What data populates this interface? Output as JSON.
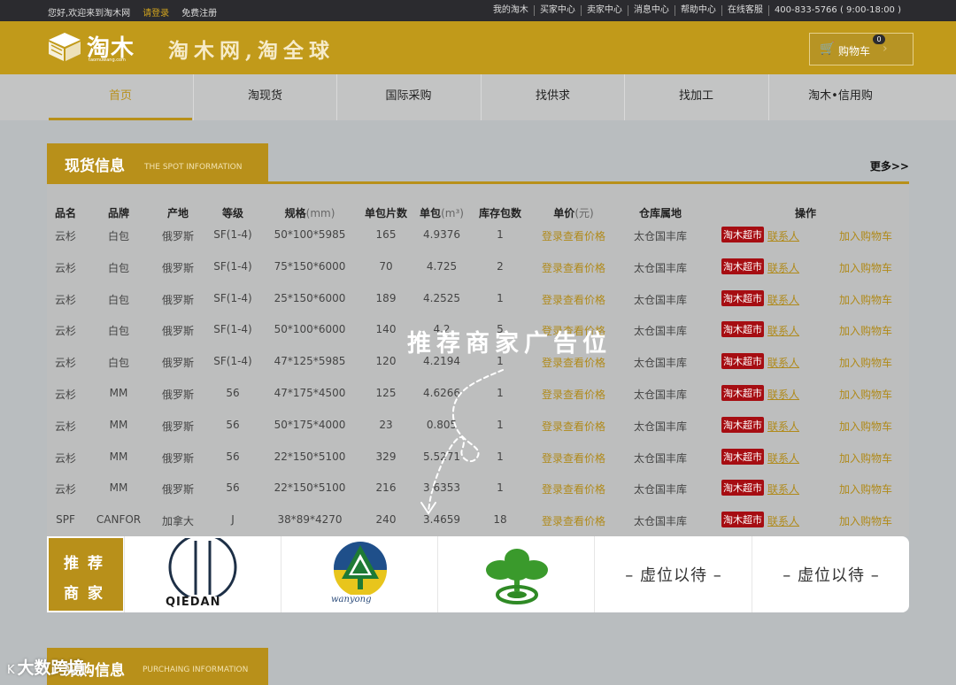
{
  "topbar": {
    "greeting": "您好,欢迎来到淘木网",
    "login": "请登录",
    "register": "免费注册",
    "links": [
      "我的淘木",
      "买家中心",
      "卖家中心",
      "消息中心",
      "帮助中心",
      "在线客服",
      "400-833-5766 ( 9:00-18:00 )"
    ]
  },
  "header": {
    "logo_text": "淘木",
    "logo_url": "taomuwang.com",
    "slogan": "淘木网,淘全球",
    "cart_label": "购物车",
    "cart_count": "0"
  },
  "nav": [
    "首页",
    "淘现货",
    "国际采购",
    "找供求",
    "找加工",
    "淘木•信用购"
  ],
  "spot": {
    "title": "现货信息",
    "subtitle": "THE SPOT INFORMATION",
    "more": "更多>>",
    "columns": [
      {
        "label": "品名",
        "unit": ""
      },
      {
        "label": "品牌",
        "unit": ""
      },
      {
        "label": "产地",
        "unit": ""
      },
      {
        "label": "等级",
        "unit": ""
      },
      {
        "label": "规格",
        "unit": "(mm)"
      },
      {
        "label": "单包片数",
        "unit": ""
      },
      {
        "label": "单包",
        "unit": "(m³)"
      },
      {
        "label": "库存包数",
        "unit": ""
      },
      {
        "label": "单价",
        "unit": "(元)"
      },
      {
        "label": "仓库属地",
        "unit": ""
      },
      {
        "label": "操作",
        "unit": ""
      }
    ],
    "price_text": "登录查看价格",
    "badge_text": "淘木超市",
    "contact_text": "联系人",
    "add_text": "加入购物车",
    "rows": [
      [
        "云杉",
        "白包",
        "俄罗斯",
        "SF(1-4)",
        "50*100*5985",
        "165",
        "4.9376",
        "1",
        "太仓国丰库"
      ],
      [
        "云杉",
        "白包",
        "俄罗斯",
        "SF(1-4)",
        "75*150*6000",
        "70",
        "4.725",
        "2",
        "太仓国丰库"
      ],
      [
        "云杉",
        "白包",
        "俄罗斯",
        "SF(1-4)",
        "25*150*6000",
        "189",
        "4.2525",
        "1",
        "太仓国丰库"
      ],
      [
        "云杉",
        "白包",
        "俄罗斯",
        "SF(1-4)",
        "50*100*6000",
        "140",
        "4.2",
        "5",
        "太仓国丰库"
      ],
      [
        "云杉",
        "白包",
        "俄罗斯",
        "SF(1-4)",
        "47*125*5985",
        "120",
        "4.2194",
        "1",
        "太仓国丰库"
      ],
      [
        "云杉",
        "MM",
        "俄罗斯",
        "56",
        "47*175*4500",
        "125",
        "4.6266",
        "1",
        "太仓国丰库"
      ],
      [
        "云杉",
        "MM",
        "俄罗斯",
        "56",
        "50*175*4000",
        "23",
        "0.805",
        "1",
        "太仓国丰库"
      ],
      [
        "云杉",
        "MM",
        "俄罗斯",
        "56",
        "22*150*5100",
        "329",
        "5.5271",
        "1",
        "太仓国丰库"
      ],
      [
        "云杉",
        "MM",
        "俄罗斯",
        "56",
        "22*150*5100",
        "216",
        "3.6353",
        "1",
        "太仓国丰库"
      ],
      [
        "SPF",
        "CANFOR",
        "加拿大",
        "J",
        "38*89*4270",
        "240",
        "3.4659",
        "18",
        "太仓国丰库"
      ]
    ]
  },
  "overlay_text": "推荐商家广告位",
  "recommend": {
    "tag_line1": "推荐",
    "tag_line2": "商家",
    "brands": [
      "QIEDAN",
      "wanyong"
    ],
    "vacant": [
      "– 虚位以待 –",
      "– 虚位以待 –"
    ]
  },
  "purchase": {
    "title": "采购信息",
    "subtitle": "PURCHAING INFORMATION"
  },
  "watermark": "大数跨境",
  "colors": {
    "gold": "#b8901a",
    "dark_bar": "#2b2b2f",
    "badge_red": "#a60d12"
  }
}
